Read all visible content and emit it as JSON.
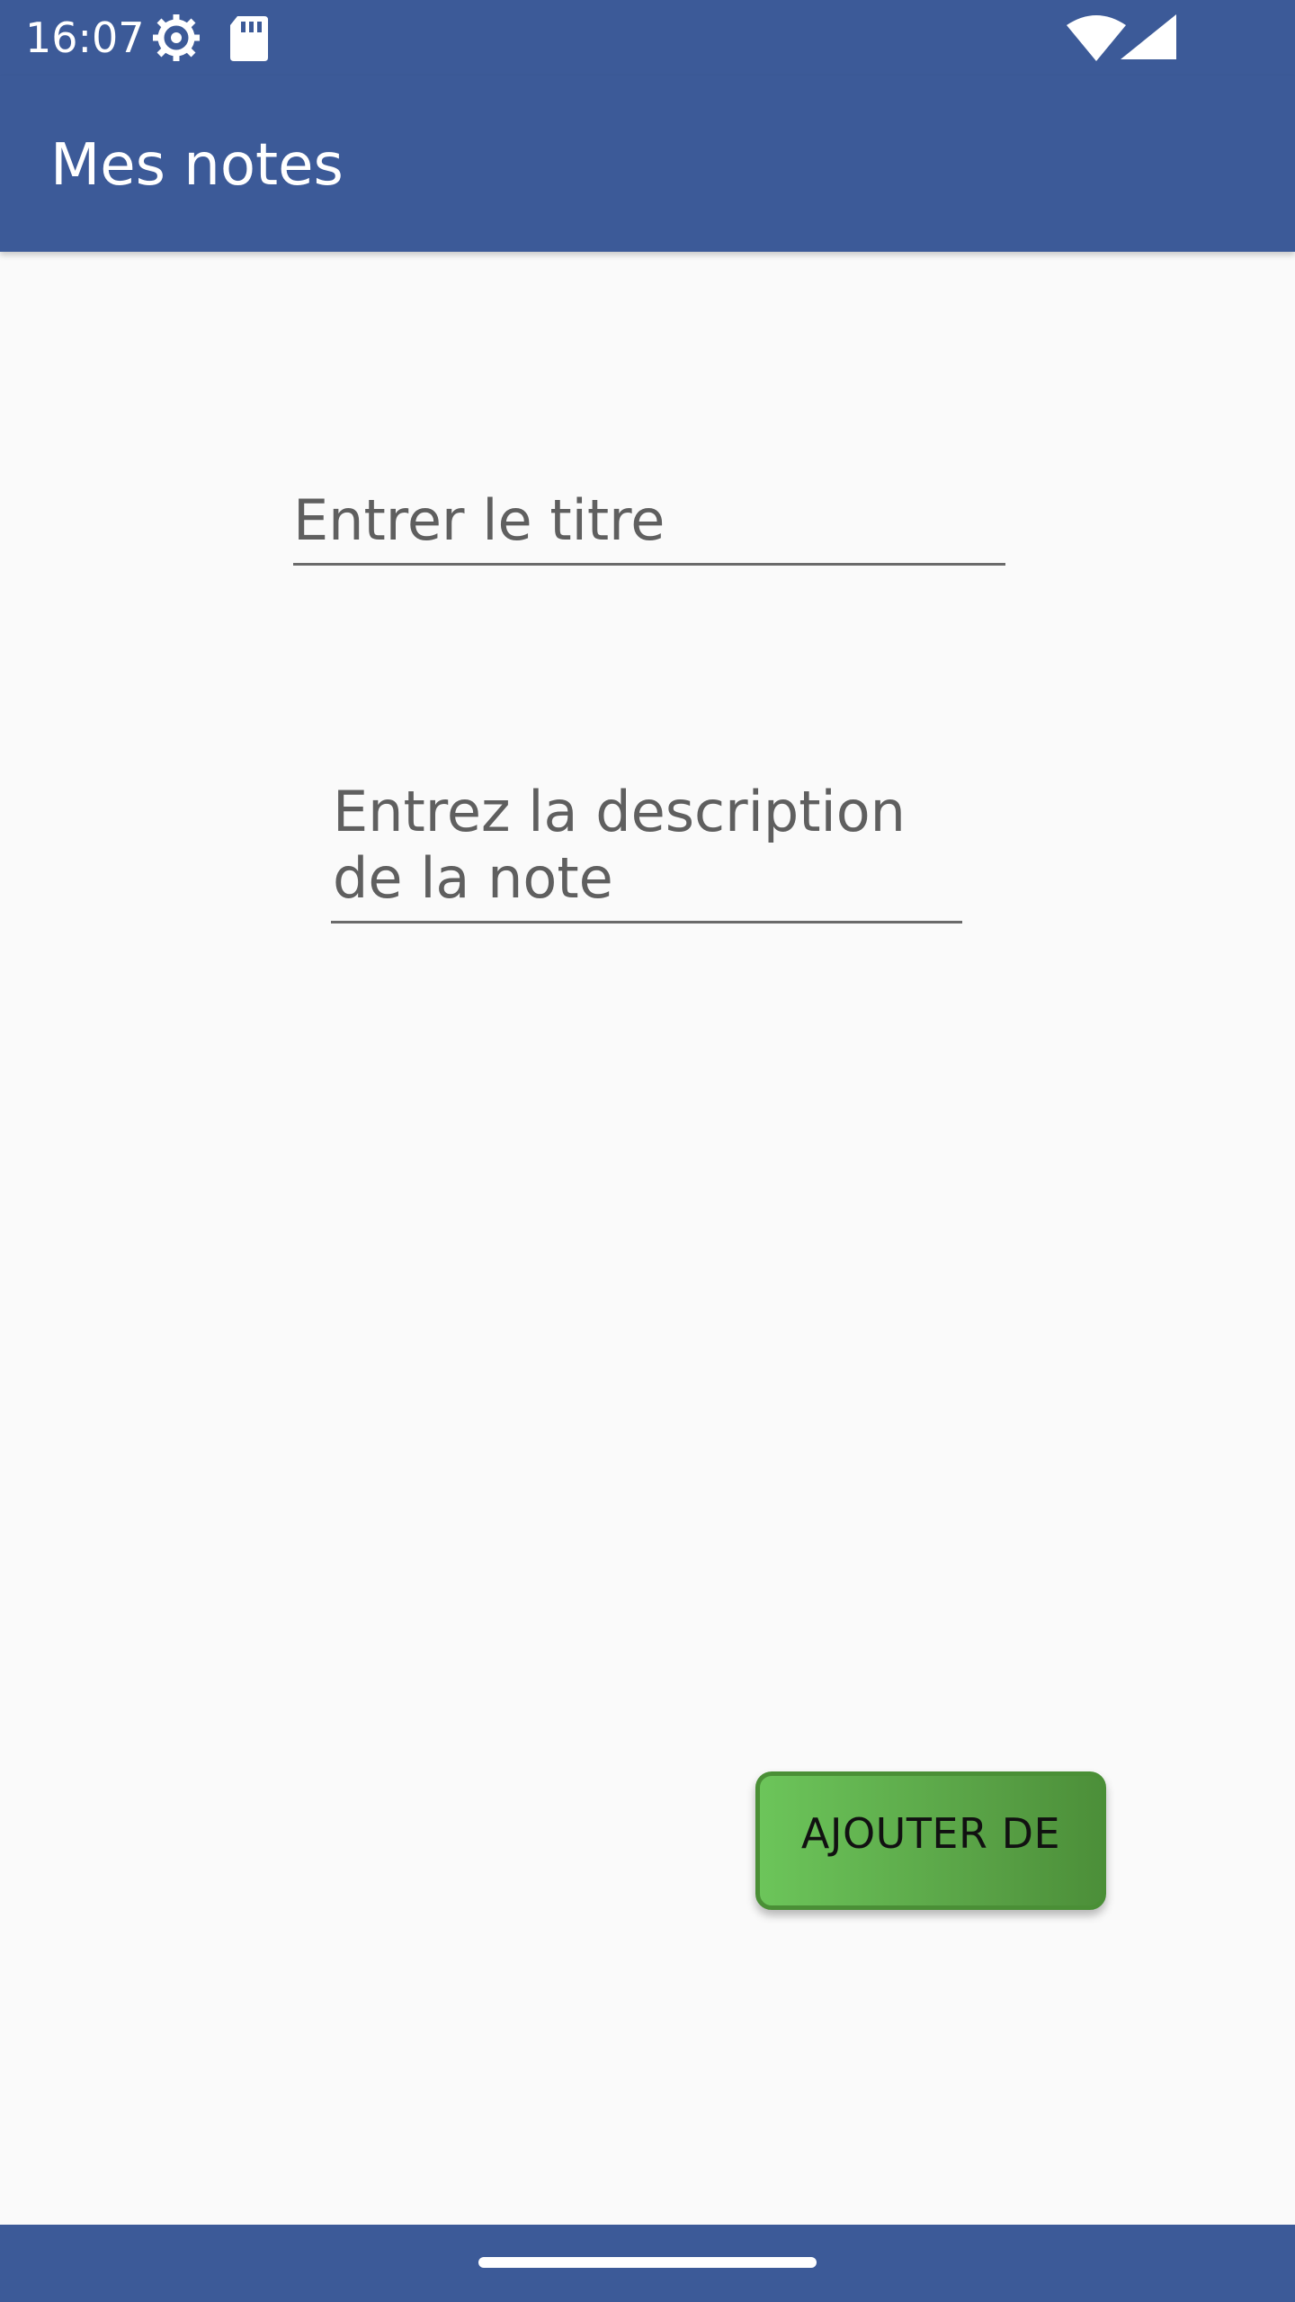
{
  "status_bar": {
    "time": "16:07",
    "icons": [
      "settings-gear-icon",
      "sd-card-icon",
      "wifi-icon",
      "signal-icon"
    ]
  },
  "app_bar": {
    "title": "Mes notes"
  },
  "form": {
    "title_placeholder": "Entrer le titre",
    "description_placeholder": "Entrez la description de la note",
    "add_button_label": "AJOUTER DE"
  },
  "colors": {
    "primary": "#3c5a98",
    "background": "#fafafa",
    "button_green": "#6cc55a",
    "button_border": "#4a8f36"
  }
}
